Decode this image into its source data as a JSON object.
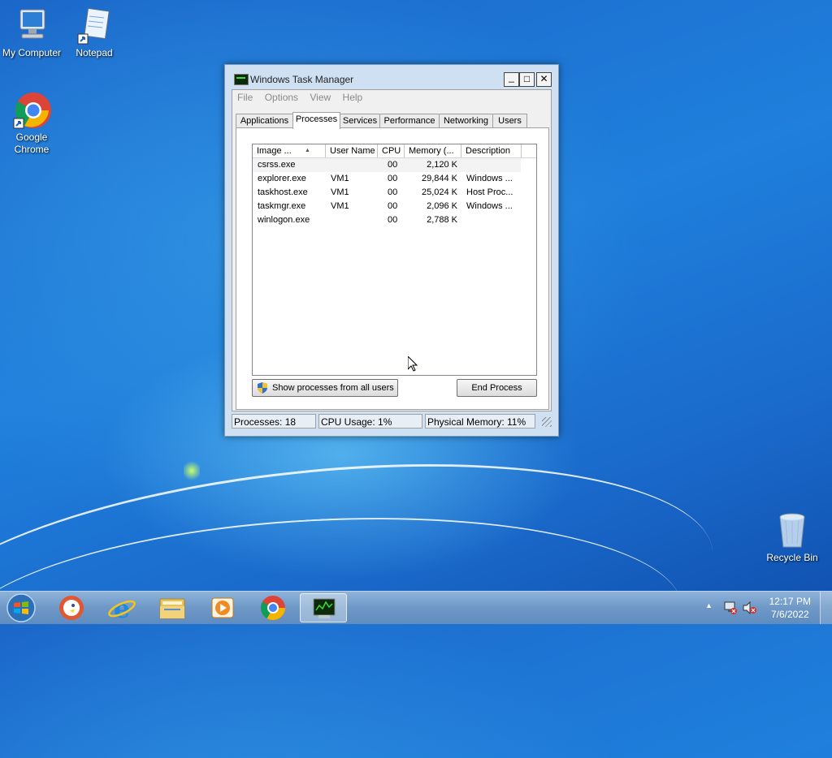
{
  "desktop": {
    "icons": [
      {
        "label": "My Computer"
      },
      {
        "label": "Notepad"
      },
      {
        "label": "Google Chrome"
      },
      {
        "label": "Recycle Bin"
      }
    ]
  },
  "window": {
    "title": "Windows Task Manager",
    "controls": {
      "minimize": "_",
      "maximize": "□",
      "close": "✕"
    },
    "menu": [
      "File",
      "Options",
      "View",
      "Help"
    ],
    "tabs": [
      "Applications",
      "Processes",
      "Services",
      "Performance",
      "Networking",
      "Users"
    ],
    "active_tab": "Processes",
    "columns": [
      "Image ...",
      "User Name",
      "CPU",
      "Memory (...",
      "Description"
    ],
    "sort_indicator": "▲",
    "processes": [
      {
        "image": "csrss.exe",
        "user": "",
        "cpu": "00",
        "memory": "2,120 K",
        "description": ""
      },
      {
        "image": "explorer.exe",
        "user": "VM1",
        "cpu": "00",
        "memory": "29,844 K",
        "description": "Windows ..."
      },
      {
        "image": "taskhost.exe",
        "user": "VM1",
        "cpu": "00",
        "memory": "25,024 K",
        "description": "Host Proc..."
      },
      {
        "image": "taskmgr.exe",
        "user": "VM1",
        "cpu": "00",
        "memory": "2,096 K",
        "description": "Windows ..."
      },
      {
        "image": "winlogon.exe",
        "user": "",
        "cpu": "00",
        "memory": "2,788 K",
        "description": ""
      }
    ],
    "show_all_button": "Show processes from all users",
    "end_process_button": "End Process",
    "status": {
      "processes": "Processes: 18",
      "cpu": "CPU Usage: 1%",
      "memory": "Physical Memory: 11%"
    }
  },
  "taskbar": {
    "apps": [
      "start-orb",
      "duckduckgo-icon",
      "internet-explorer-icon",
      "file-explorer-icon",
      "media-player-icon",
      "chrome-icon",
      "task-manager-icon"
    ],
    "tray_arrow": "▲",
    "time": "12:17 PM",
    "date": "7/6/2022"
  },
  "colors": {
    "desktop": "#1b6cd0",
    "taskbar": "#6e98c7",
    "window_frame": "#cfe0f2"
  }
}
